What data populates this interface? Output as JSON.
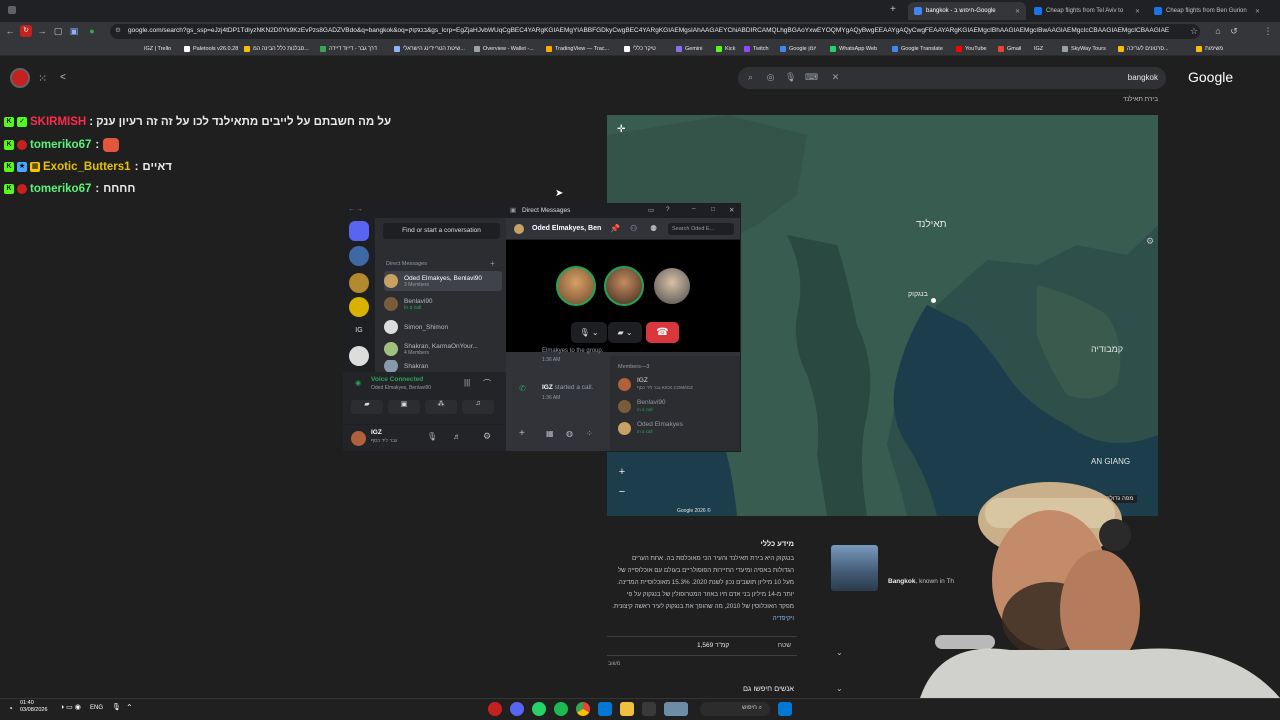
{
  "browser": {
    "tabs": [
      {
        "label": "bangkok - חיפוש ב-Google",
        "active": true,
        "color": "#4285f4"
      },
      {
        "label": "Cheap flights from Tel Aviv to",
        "active": false,
        "color": "#1a73e8"
      },
      {
        "label": "Cheap flights from Ben Gurion",
        "active": false,
        "color": "#1a73e8"
      }
    ],
    "url": "google.com/search?gs_ssp=eJzj4tDP1TdIyzNKN2D0Yk9KzEvPzs8GADZVBdo&q=bangkok&oq=בנגקוק&gs_lcrp=EgZjaHJvbWUqCgBEC4YARgKGIAEMgYIABBFGDkyCwgBEC4YARgKGIAEMgsIAhAAGAEYChiABDIRCAMQLhgBGAoYxwEYOQMYgAQyBwgEEAAYgAQyCwgFEAAYARgKGIAEMgcIBhAAGIAEMgcIBwAAGIAEMgcIcCBAAGIAEMgcICBAAGIAE",
    "bookmarks": [
      "IGZ | Trello",
      "Paletools v26.0.28",
      "סבלנות כלל הבינה המ...",
      "דרך גבר - דייוד דיידה",
      "שיטת הטריידינג הישראלי...",
      "Overview - Wallet -...",
      "TradingView — Trac...",
      "טיקר כללי",
      "Gemini",
      "Kick",
      "Twitch",
      "Google יומן",
      "WhatsApp Web",
      "Google Translate",
      "YouTube",
      "Gmail",
      "IGZ",
      "SkyWay Tours",
      "סרטונים לעריכה...",
      "משימות"
    ]
  },
  "google": {
    "query": "bangkok",
    "logo": "Google",
    "breadcrumb": "בירת תאילנד",
    "map_labels": {
      "thailand": "תאילנד",
      "bangkok": "בנגקוק",
      "cambodia": "קמבודיה",
      "an_giang": "AN GIANG",
      "footer": "Google 2026 ©",
      "fullscreen": "מפה גדולה"
    },
    "kp_title": "מידע כללי",
    "kp_description": "בנגקוק היא בירת תאילנד והעיר הכי מאוכלסת בה. אחת הערים הגדולות באסיה ומיעדי התיירות הפופולריים בעולם עם אוכלוסייה של מעל 10 מיליון תושבים נכון לשנת 2020. 15.3% מאוכלוסיית המדינה. יותר מ-14 מיליון בני אדם חיו באזור המטרופולין של בנגקוק על פי מפקד האוכלוסין של 2010, מה שהופך את בנגקוק לעיר ראשה קיצונית.",
    "kp_wiki": "ויקיפדיה",
    "kp_row_label": "שטח",
    "kp_row_value": "1,569 קמ\"ר",
    "kp_row_note": "משוב",
    "kp_sub": "אנשים חיפשו גם",
    "card_title": "Bangkok",
    "card_snippet": ", known in Th"
  },
  "chat": [
    {
      "user": "SKIRMISH",
      "color": "#ff2b4a",
      "message": "על מה חשבתם על לייבים מתאילנד לכו על זה זה רעיון ענק"
    },
    {
      "user": "tomeriko67",
      "color": "#5cf27a",
      "message": ""
    },
    {
      "user": "Exotic_Butters1",
      "color": "#e6c200",
      "message": "דאיים"
    },
    {
      "user": "tomeriko67",
      "color": "#5cf27a",
      "message": "חחחח"
    }
  ],
  "discord": {
    "window_title": "Direct Messages",
    "find_placeholder": "Find or start a conversation",
    "dm_header": "Direct Messages",
    "dms": [
      {
        "name": "Oded Elmakyes, Benlavi90",
        "sub": "3 Members",
        "color": "#c8a165"
      },
      {
        "name": "Benlavi90",
        "sub": "In a call",
        "color": "#7a5c3a"
      },
      {
        "name": "Simon_Shimon",
        "sub": "",
        "color": "#dddddd"
      },
      {
        "name": "Shakran, KarmaOnYour...",
        "sub": "4 Members",
        "color": "#a0c080"
      },
      {
        "name": "Shakran",
        "sub": "",
        "color": "#8899aa"
      }
    ],
    "voice_status": "Voice Connected",
    "voice_channel": "Oded Elmakyes, Benlavi90",
    "user_name": "IGZ",
    "user_status": "גבר ליד כסף",
    "conv_title": "Oded Elmakyes, Ben",
    "search_placeholder": "Search Oded E...",
    "msg_user": "IGZ",
    "msg_text": "started a call.",
    "msg_time": "1:36 AM",
    "prev_group": "Elmakyes to the group.",
    "prev_time": "1:36 AM",
    "members_header": "Members—3",
    "members": [
      {
        "name": "IGZ",
        "sub": "גבר ליד כסף KICK.COM/IGZ",
        "color": "#b0603a"
      },
      {
        "name": "Benlavi90",
        "sub": "In a call",
        "color": "#7a5c3a"
      },
      {
        "name": "Oded Elmakyes",
        "sub": "In a call",
        "color": "#c8a165"
      }
    ]
  },
  "taskbar": {
    "time": "01:40",
    "date": "03/08/2026",
    "lang": "ENG",
    "search": "חיפוש"
  }
}
